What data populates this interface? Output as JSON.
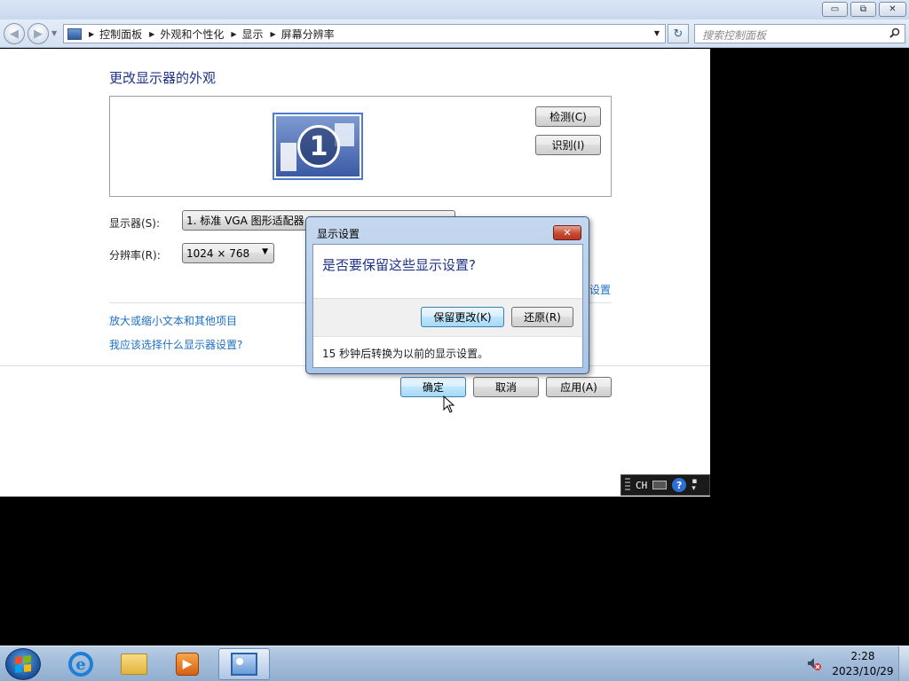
{
  "window": {
    "caption_buttons": {
      "minimize": "▭",
      "maximize": "⧉",
      "close": "✕"
    }
  },
  "navbar": {
    "breadcrumbs": [
      "控制面板",
      "外观和个性化",
      "显示",
      "屏幕分辨率"
    ],
    "search_placeholder": "搜索控制面板"
  },
  "main": {
    "title": "更改显示器的外观",
    "monitor_number": "1",
    "detect_button": "检测(C)",
    "identify_button": "识别(I)",
    "display_label": "显示器(S):",
    "display_value": "1. 标准 VGA 图形适配器",
    "resolution_label": "分辨率(R):",
    "resolution_value": "1024 × 768",
    "advanced_link_partial": "设置",
    "link_text_size": "放大或缩小文本和其他项目",
    "link_which_settings": "我应该选择什么显示器设置?",
    "ok_button": "确定",
    "cancel_button": "取消",
    "apply_button": "应用(A)"
  },
  "dialog": {
    "title": "显示设置",
    "question": "是否要保留这些显示设置?",
    "keep_button": "保留更改(K)",
    "revert_button": "还原(R)",
    "countdown": "15 秒钟后转换为以前的显示设置。"
  },
  "langbar": {
    "language": "CH",
    "help": "?"
  },
  "taskbar": {
    "apps": [
      "internet-explorer",
      "windows-explorer",
      "media-player",
      "control-panel"
    ],
    "active_app": "control-panel",
    "clock_time": "2:28",
    "clock_date": "2023/10/29"
  },
  "colors": {
    "title_blue": "#1e3287",
    "link_blue": "#1d6fc3",
    "dialog_frame": "#a9c4e6",
    "taskbar": "#a5bedb"
  }
}
